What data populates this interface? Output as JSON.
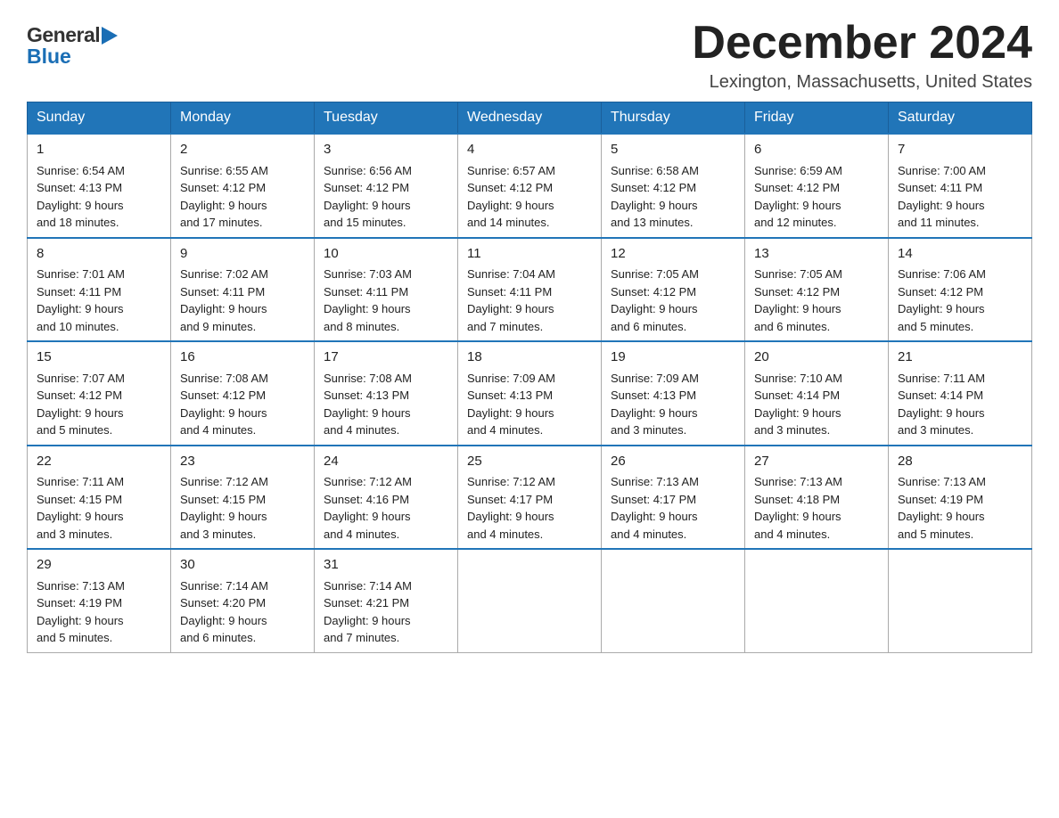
{
  "header": {
    "logo_general": "General",
    "logo_blue": "Blue",
    "month_title": "December 2024",
    "location": "Lexington, Massachusetts, United States"
  },
  "weekdays": [
    "Sunday",
    "Monday",
    "Tuesday",
    "Wednesday",
    "Thursday",
    "Friday",
    "Saturday"
  ],
  "weeks": [
    [
      {
        "day": "1",
        "sunrise": "6:54 AM",
        "sunset": "4:13 PM",
        "daylight": "9 hours and 18 minutes."
      },
      {
        "day": "2",
        "sunrise": "6:55 AM",
        "sunset": "4:12 PM",
        "daylight": "9 hours and 17 minutes."
      },
      {
        "day": "3",
        "sunrise": "6:56 AM",
        "sunset": "4:12 PM",
        "daylight": "9 hours and 15 minutes."
      },
      {
        "day": "4",
        "sunrise": "6:57 AM",
        "sunset": "4:12 PM",
        "daylight": "9 hours and 14 minutes."
      },
      {
        "day": "5",
        "sunrise": "6:58 AM",
        "sunset": "4:12 PM",
        "daylight": "9 hours and 13 minutes."
      },
      {
        "day": "6",
        "sunrise": "6:59 AM",
        "sunset": "4:12 PM",
        "daylight": "9 hours and 12 minutes."
      },
      {
        "day": "7",
        "sunrise": "7:00 AM",
        "sunset": "4:11 PM",
        "daylight": "9 hours and 11 minutes."
      }
    ],
    [
      {
        "day": "8",
        "sunrise": "7:01 AM",
        "sunset": "4:11 PM",
        "daylight": "9 hours and 10 minutes."
      },
      {
        "day": "9",
        "sunrise": "7:02 AM",
        "sunset": "4:11 PM",
        "daylight": "9 hours and 9 minutes."
      },
      {
        "day": "10",
        "sunrise": "7:03 AM",
        "sunset": "4:11 PM",
        "daylight": "9 hours and 8 minutes."
      },
      {
        "day": "11",
        "sunrise": "7:04 AM",
        "sunset": "4:11 PM",
        "daylight": "9 hours and 7 minutes."
      },
      {
        "day": "12",
        "sunrise": "7:05 AM",
        "sunset": "4:12 PM",
        "daylight": "9 hours and 6 minutes."
      },
      {
        "day": "13",
        "sunrise": "7:05 AM",
        "sunset": "4:12 PM",
        "daylight": "9 hours and 6 minutes."
      },
      {
        "day": "14",
        "sunrise": "7:06 AM",
        "sunset": "4:12 PM",
        "daylight": "9 hours and 5 minutes."
      }
    ],
    [
      {
        "day": "15",
        "sunrise": "7:07 AM",
        "sunset": "4:12 PM",
        "daylight": "9 hours and 5 minutes."
      },
      {
        "day": "16",
        "sunrise": "7:08 AM",
        "sunset": "4:12 PM",
        "daylight": "9 hours and 4 minutes."
      },
      {
        "day": "17",
        "sunrise": "7:08 AM",
        "sunset": "4:13 PM",
        "daylight": "9 hours and 4 minutes."
      },
      {
        "day": "18",
        "sunrise": "7:09 AM",
        "sunset": "4:13 PM",
        "daylight": "9 hours and 4 minutes."
      },
      {
        "day": "19",
        "sunrise": "7:09 AM",
        "sunset": "4:13 PM",
        "daylight": "9 hours and 3 minutes."
      },
      {
        "day": "20",
        "sunrise": "7:10 AM",
        "sunset": "4:14 PM",
        "daylight": "9 hours and 3 minutes."
      },
      {
        "day": "21",
        "sunrise": "7:11 AM",
        "sunset": "4:14 PM",
        "daylight": "9 hours and 3 minutes."
      }
    ],
    [
      {
        "day": "22",
        "sunrise": "7:11 AM",
        "sunset": "4:15 PM",
        "daylight": "9 hours and 3 minutes."
      },
      {
        "day": "23",
        "sunrise": "7:12 AM",
        "sunset": "4:15 PM",
        "daylight": "9 hours and 3 minutes."
      },
      {
        "day": "24",
        "sunrise": "7:12 AM",
        "sunset": "4:16 PM",
        "daylight": "9 hours and 4 minutes."
      },
      {
        "day": "25",
        "sunrise": "7:12 AM",
        "sunset": "4:17 PM",
        "daylight": "9 hours and 4 minutes."
      },
      {
        "day": "26",
        "sunrise": "7:13 AM",
        "sunset": "4:17 PM",
        "daylight": "9 hours and 4 minutes."
      },
      {
        "day": "27",
        "sunrise": "7:13 AM",
        "sunset": "4:18 PM",
        "daylight": "9 hours and 4 minutes."
      },
      {
        "day": "28",
        "sunrise": "7:13 AM",
        "sunset": "4:19 PM",
        "daylight": "9 hours and 5 minutes."
      }
    ],
    [
      {
        "day": "29",
        "sunrise": "7:13 AM",
        "sunset": "4:19 PM",
        "daylight": "9 hours and 5 minutes."
      },
      {
        "day": "30",
        "sunrise": "7:14 AM",
        "sunset": "4:20 PM",
        "daylight": "9 hours and 6 minutes."
      },
      {
        "day": "31",
        "sunrise": "7:14 AM",
        "sunset": "4:21 PM",
        "daylight": "9 hours and 7 minutes."
      },
      null,
      null,
      null,
      null
    ]
  ],
  "labels": {
    "sunrise": "Sunrise:",
    "sunset": "Sunset:",
    "daylight": "Daylight:"
  }
}
